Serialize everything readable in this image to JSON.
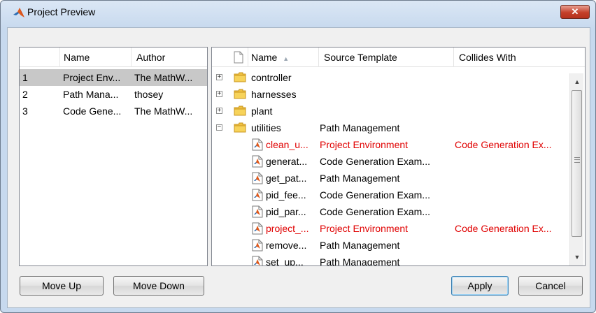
{
  "window": {
    "title": "Project Preview",
    "close_glyph": "✕",
    "close_color": "#c4402a"
  },
  "left_table": {
    "columns": [
      "Name",
      "Author"
    ],
    "rows": [
      {
        "index": "1",
        "name": "Project Env...",
        "author": "The MathW...",
        "selected": true
      },
      {
        "index": "2",
        "name": "Path Mana...",
        "author": "thosey",
        "selected": false
      },
      {
        "index": "3",
        "name": "Code Gene...",
        "author": "The MathW...",
        "selected": false
      }
    ]
  },
  "right_table": {
    "columns": [
      "Name",
      "Source Template",
      "Collides With"
    ],
    "sort_indicator": "▲",
    "folders": [
      {
        "name": "controller",
        "expander": "+",
        "source": "",
        "collides": ""
      },
      {
        "name": "harnesses",
        "expander": "+",
        "source": "",
        "collides": ""
      },
      {
        "name": "plant",
        "expander": "+",
        "source": "",
        "collides": ""
      },
      {
        "name": "utilities",
        "expander": "−",
        "source": "Path Management",
        "collides": ""
      }
    ],
    "files": [
      {
        "name": "clean_u...",
        "source": "Project Environment",
        "collides": "Code Generation Ex...",
        "conflict": true
      },
      {
        "name": "generat...",
        "source": "Code Generation Exam...",
        "collides": "",
        "conflict": false
      },
      {
        "name": "get_pat...",
        "source": "Path Management",
        "collides": "",
        "conflict": false
      },
      {
        "name": "pid_fee...",
        "source": "Code Generation Exam...",
        "collides": "",
        "conflict": false
      },
      {
        "name": "pid_par...",
        "source": "Code Generation Exam...",
        "collides": "",
        "conflict": false
      },
      {
        "name": "project_...",
        "source": "Project Environment",
        "collides": "Code Generation Ex...",
        "conflict": true
      },
      {
        "name": "remove...",
        "source": "Path Management",
        "collides": "",
        "conflict": false
      },
      {
        "name": "set_up...",
        "source": "Path Management",
        "collides": "",
        "conflict": false
      }
    ],
    "conflict_color": "#e00000"
  },
  "scrollbar": {
    "up_glyph": "▲",
    "down_glyph": "▼"
  },
  "buttons": {
    "move_up": "Move Up",
    "move_down": "Move Down",
    "apply": "Apply",
    "cancel": "Cancel"
  },
  "icons": {
    "app": "matlab-logo-icon",
    "folder": "folder-icon",
    "file": "matlab-file-icon",
    "header_file": "file-icon"
  }
}
